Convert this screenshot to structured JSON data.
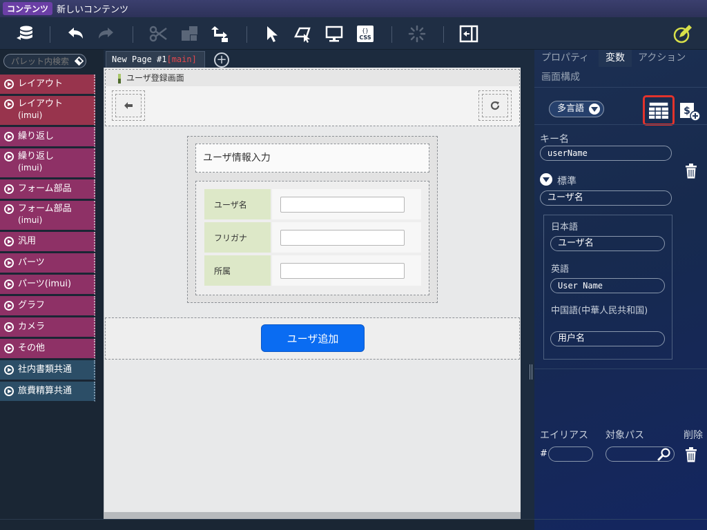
{
  "titlebar": {
    "badge": "コンテンツ",
    "title": "新しいコンテンツ"
  },
  "toolbar": {
    "icons": [
      "database-icon",
      "undo-icon",
      "redo-icon",
      "cut-icon",
      "copy-icon",
      "tree-icon",
      "pointer-icon",
      "component-icon",
      "monitor-icon",
      "css-icon",
      "loading-icon",
      "screen-transition-icon",
      "edit-icon"
    ]
  },
  "palette": {
    "search_placeholder": "パレット内検索",
    "items": [
      {
        "label": "レイアウト",
        "sub": "",
        "color": "#98344d"
      },
      {
        "label": "レイアウト",
        "sub": "(imui)",
        "color": "#98344d"
      },
      {
        "label": "繰り返し",
        "sub": "",
        "color": "#8e3166"
      },
      {
        "label": "繰り返し",
        "sub": "(imui)",
        "color": "#8e3166"
      },
      {
        "label": "フォーム部品",
        "sub": "",
        "color": "#8e3166"
      },
      {
        "label": "フォーム部品",
        "sub": "(imui)",
        "color": "#8e3166"
      },
      {
        "label": "汎用",
        "sub": "",
        "color": "#8e3166"
      },
      {
        "label": "パーツ",
        "sub": "",
        "color": "#8e3166"
      },
      {
        "label": "パーツ(imui)",
        "sub": "",
        "color": "#8e3166"
      },
      {
        "label": "グラフ",
        "sub": "",
        "color": "#8e3166"
      },
      {
        "label": "カメラ",
        "sub": "",
        "color": "#8e3166"
      },
      {
        "label": "その他",
        "sub": "",
        "color": "#8e3166"
      },
      {
        "label": "社内書類共通",
        "sub": "",
        "color": "#2c4e67"
      },
      {
        "label": "旅費精算共通",
        "sub": "",
        "color": "#2c4e67"
      }
    ]
  },
  "tabs": {
    "page_name": "New Page #1",
    "page_suffix": "[main]",
    "add": "+"
  },
  "canvas": {
    "header_title": "ユーザ登録画面",
    "form_title": "ユーザ情報入力",
    "rows": [
      {
        "label": "ユーザ名"
      },
      {
        "label": "フリガナ"
      },
      {
        "label": "所属"
      }
    ],
    "add_button": "ユーザ追加"
  },
  "rpanel": {
    "tabs": [
      "プロパティ",
      "変数",
      "アクション"
    ],
    "active_tab": "変数",
    "screen_tab": "画面構成",
    "lang_button": "多言語",
    "key_label": "キー名",
    "key_value": "userName",
    "standard_label": "標準",
    "standard_value": "ユーザ名",
    "langs": [
      {
        "label": "日本語",
        "value": "ユーザ名",
        "mono": false
      },
      {
        "label": "英語",
        "value": "User Name",
        "mono": true
      },
      {
        "label": "中国語(中華人民共和国)",
        "value": "用户名",
        "mono": false
      }
    ],
    "alias_label": "エイリアス",
    "target_label": "対象パス",
    "delete_label": "削除",
    "hash": "#",
    "alias_value": "",
    "target_value": ""
  },
  "colors": {
    "accent_blue": "#0a6cf2",
    "highlight_red": "#e3332c",
    "label_green": "#dde8c8"
  }
}
